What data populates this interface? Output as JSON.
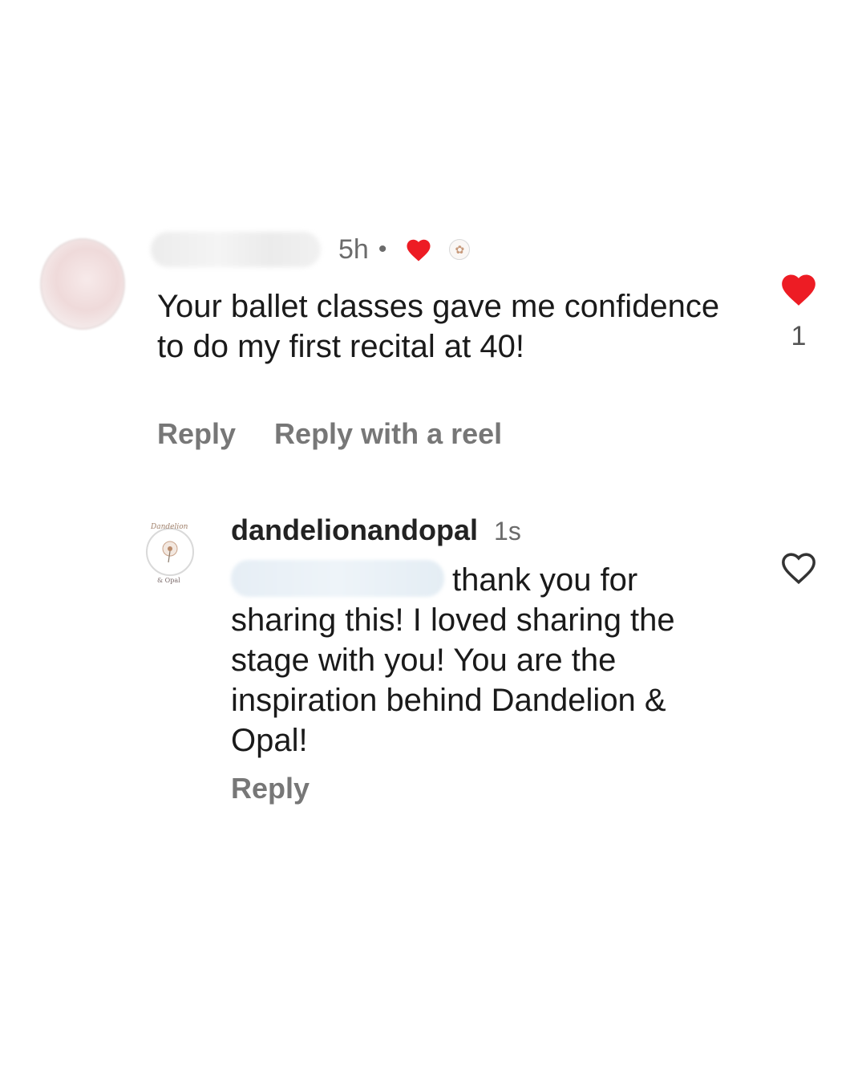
{
  "comment": {
    "timestamp": "5h",
    "separator": "•",
    "text": "Your ballet classes gave me confidence to do my first recital at 40!",
    "actions": {
      "reply": "Reply",
      "reply_reel": "Reply with a reel"
    },
    "like_count": "1",
    "liked": true,
    "heart_color": "#ed1c24"
  },
  "reply": {
    "username": "dandelionandopal",
    "timestamp": "1s",
    "text": "thank you for sharing this! I loved sharing the stage with you! You are the inspiration behind Dandelion & Opal!",
    "avatar_logo": {
      "top": "Dandelion",
      "bottom": "& Opal"
    },
    "actions": {
      "reply": "Reply"
    },
    "liked": false
  },
  "icons": [
    "heart-filled-icon",
    "heart-outline-icon"
  ]
}
